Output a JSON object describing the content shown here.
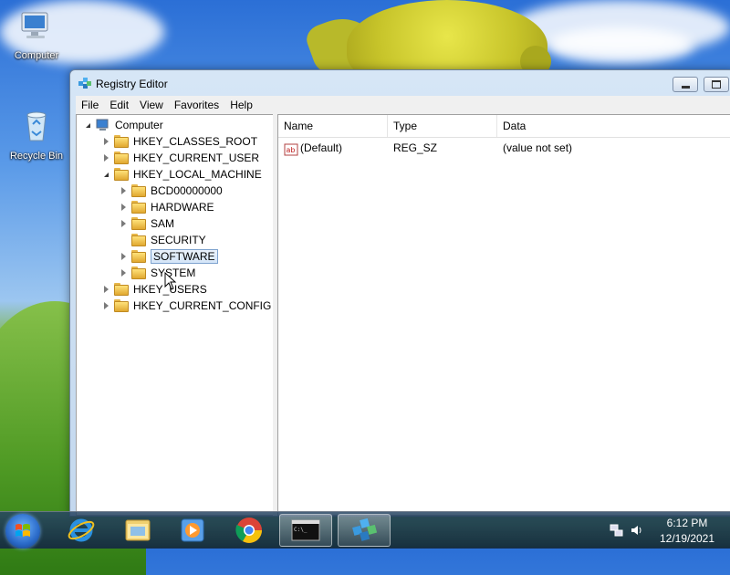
{
  "desktop": {
    "icons": [
      {
        "label": "Computer",
        "icon": "computer-icon"
      },
      {
        "label": "Recycle Bin",
        "icon": "recycle-bin-icon"
      }
    ]
  },
  "window": {
    "title": "Registry Editor",
    "menu": [
      "File",
      "Edit",
      "View",
      "Favorites",
      "Help"
    ],
    "tree": [
      {
        "label": "Computer",
        "icon": "computer-icon",
        "expanded": true
      },
      {
        "label": "HKEY_CLASSES_ROOT",
        "expanded": false
      },
      {
        "label": "HKEY_CURRENT_USER",
        "expanded": false
      },
      {
        "label": "HKEY_LOCAL_MACHINE",
        "expanded": true
      },
      {
        "label": "BCD00000000",
        "expanded": false
      },
      {
        "label": "HARDWARE",
        "expanded": false
      },
      {
        "label": "SAM",
        "expanded": false
      },
      {
        "label": "SECURITY",
        "expanded": false
      },
      {
        "label": "SOFTWARE",
        "expanded": false,
        "selected": true
      },
      {
        "label": "SYSTEM",
        "expanded": false
      },
      {
        "label": "HKEY_USERS",
        "expanded": false
      },
      {
        "label": "HKEY_CURRENT_CONFIG",
        "expanded": false
      }
    ],
    "columns": [
      "Name",
      "Type",
      "Data"
    ],
    "values": [
      {
        "name": "(Default)",
        "type": "REG_SZ",
        "data": "(value not set)",
        "icon": "string-value-icon"
      }
    ]
  },
  "taskbar": {
    "pinned": [
      "start-orb",
      "internet-explorer-icon",
      "windows-explorer-icon",
      "media-player-icon",
      "chrome-icon",
      "command-prompt-icon",
      "registry-editor-icon"
    ],
    "active": "registry-editor-icon",
    "time": "6:12 PM",
    "date": "12/19/2021"
  },
  "colors": {
    "taskbar": "#1e3650",
    "selection": "#d4e5f8",
    "window_frame": "#c3d8ee"
  }
}
